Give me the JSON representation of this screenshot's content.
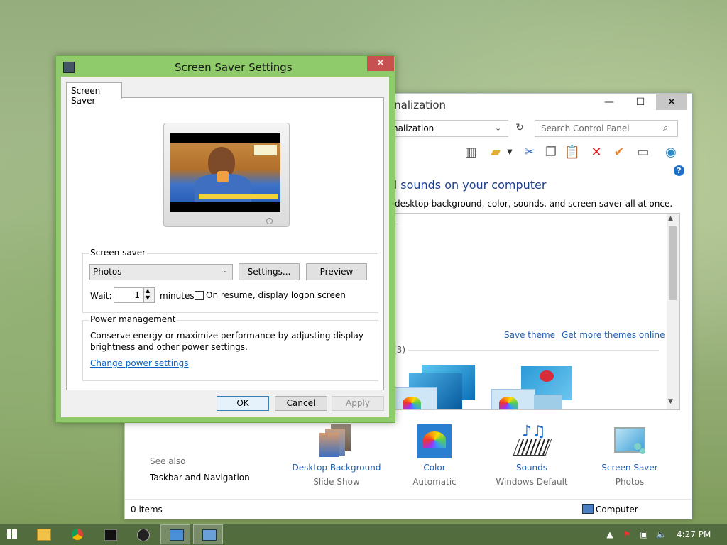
{
  "cp": {
    "title": "onalization",
    "address": "nalization",
    "search_placeholder": "Search Control Panel",
    "heading": "d sounds on your computer",
    "subtext": "desktop background, color, sounds, and screen saver all at once.",
    "save_theme": "Save theme",
    "more_themes": "Get more themes online",
    "theme_count": "(3)",
    "see_also": "See also",
    "taskbar_nav": "Taskbar and Navigation",
    "items": [
      {
        "label": "Desktop Background",
        "sub": "Slide Show"
      },
      {
        "label": "Color",
        "sub": "Automatic"
      },
      {
        "label": "Sounds",
        "sub": "Windows Default"
      },
      {
        "label": "Screen Saver",
        "sub": "Photos"
      }
    ],
    "status_items": "0 items",
    "status_location": "Computer",
    "help": "?"
  },
  "ss": {
    "title": "Screen Saver Settings",
    "tab": "Screen Saver",
    "group_label": "Screen saver",
    "selected": "Photos",
    "settings_btn": "Settings...",
    "preview_btn": "Preview",
    "wait_label": "Wait:",
    "wait_value": "1",
    "minutes": "minutes",
    "resume": "On resume, display logon screen",
    "power_label": "Power management",
    "power_text1": "Conserve energy or maximize performance by adjusting display",
    "power_text2": "brightness and other power settings.",
    "power_link": "Change power settings",
    "ok": "OK",
    "cancel": "Cancel",
    "apply": "Apply"
  },
  "taskbar": {
    "time": "4:27 PM"
  }
}
